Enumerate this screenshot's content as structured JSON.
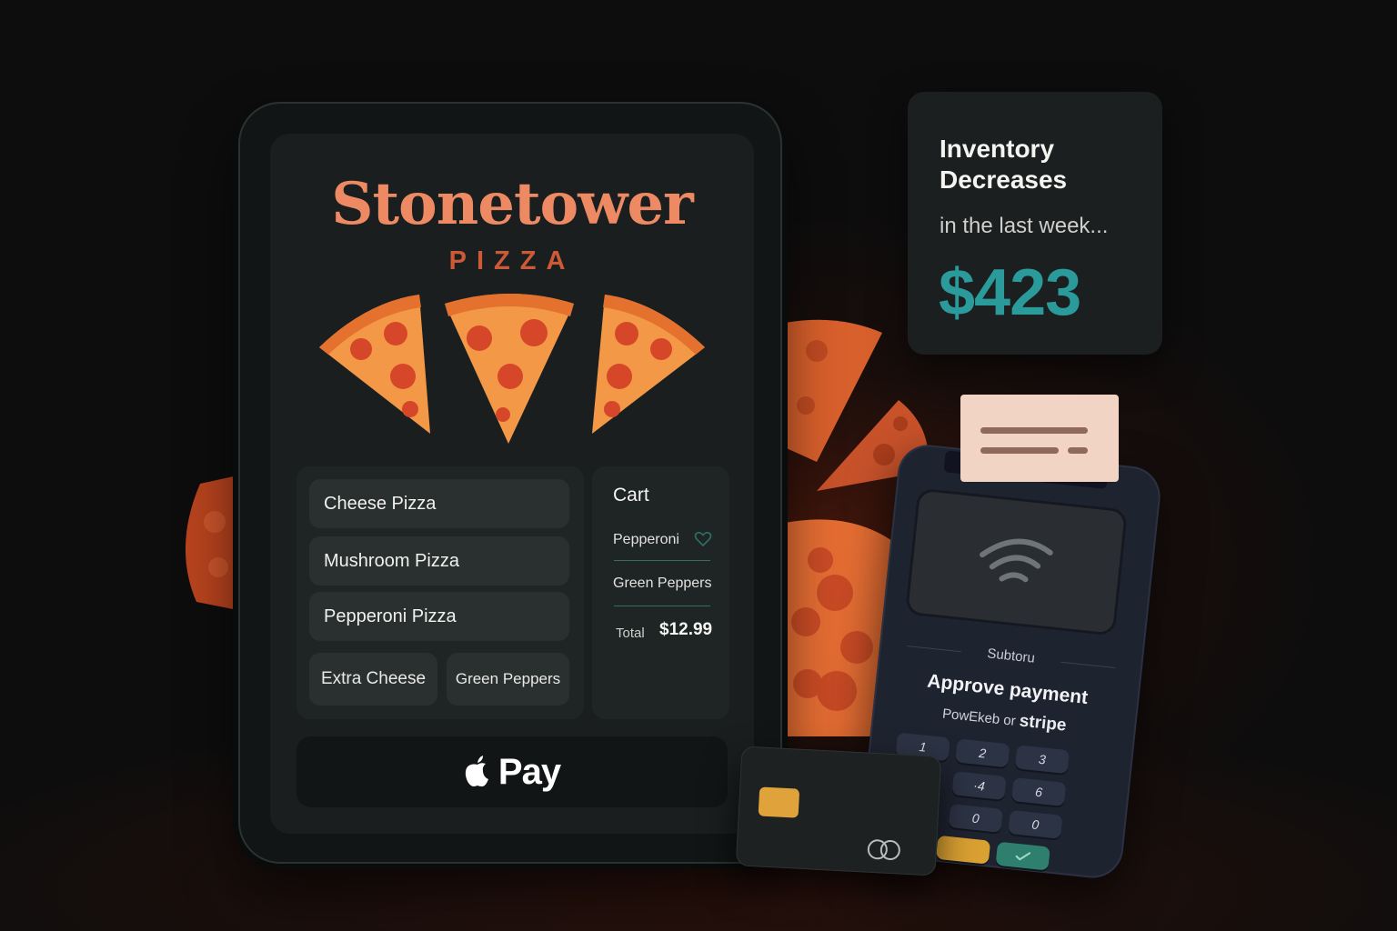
{
  "brand": {
    "name": "Stonetower",
    "sub": "PIZZA"
  },
  "menu": {
    "items": [
      {
        "label": "Cheese Pizza"
      },
      {
        "label": "Mushroom Pizza"
      },
      {
        "label": "Pepperoni Pizza"
      }
    ],
    "toppings": [
      {
        "label": "Extra Cheese"
      },
      {
        "label": "Green Peppers"
      }
    ]
  },
  "cart": {
    "title": "Cart",
    "items": [
      {
        "label": "Pepperoni",
        "icon": "heart-icon"
      },
      {
        "label": "Green Peppers"
      }
    ],
    "total_label": "Total",
    "total_value": "$12.99"
  },
  "pay_button": {
    "icon": "apple-icon",
    "label": "Pay"
  },
  "inventory": {
    "title": "Inventory Decreases",
    "subtitle": "in the last week...",
    "value": "$423"
  },
  "terminal": {
    "header": "Subtoru",
    "title": "Approve payment",
    "powered_prefix": "PowEkeb or",
    "powered_brand": "stripe",
    "icon": "contactless-icon",
    "keys": [
      "1",
      "2",
      "3",
      "·4",
      "6",
      "0",
      "0"
    ]
  },
  "colors": {
    "accent": "#ee8a63",
    "brand_sub": "#cc5a36",
    "teal": "#2a9a9b",
    "panel": "#1f2424",
    "item": "#2a302f"
  }
}
